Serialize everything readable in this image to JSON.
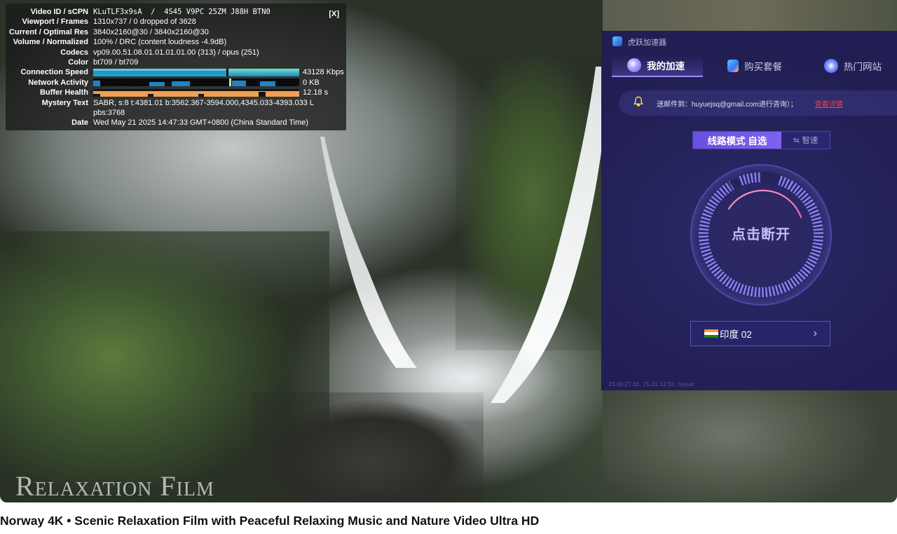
{
  "stats": {
    "close_label": "[X]",
    "rows": [
      {
        "key": "Video ID / sCPN",
        "value": "KLuTLF3x9sA  /  4S45 V9PC 25ZM J88H BTN0"
      },
      {
        "key": "Viewport / Frames",
        "value": "1310x737 / 0 dropped of 3628"
      },
      {
        "key": "Current / Optimal Res",
        "value": "3840x2160@30 / 3840x2160@30"
      },
      {
        "key": "Volume / Normalized",
        "value": "100% / DRC (content loudness -4.9dB)"
      },
      {
        "key": "Codecs",
        "value": "vp09.00.51.08.01.01.01.01.00 (313) / opus (251)"
      },
      {
        "key": "Color",
        "value": "bt709 / bt709"
      },
      {
        "key": "Connection Speed",
        "value": "43128 Kbps"
      },
      {
        "key": "Network Activity",
        "value": "0 KB"
      },
      {
        "key": "Buffer Health",
        "value": "12.18 s"
      },
      {
        "key": "Mystery Text",
        "value": "SABR, s:8 t:4381.01 b:3562.367-3594.000,4345.033-4393.033 L",
        "value2": "pbs:3768"
      },
      {
        "key": "Date",
        "value": "Wed May 21 2025 14:47:33 GMT+0800 (China Standard Time)"
      }
    ]
  },
  "watermark": "Relaxation Film",
  "app": {
    "title": "虎跃加速器",
    "tabs": [
      {
        "label": "我的加速",
        "icon": "rocket-icon",
        "active": true
      },
      {
        "label": "购买套餐",
        "icon": "shopping-bag-icon"
      },
      {
        "label": "热门网站",
        "icon": "compass-icon"
      }
    ],
    "notice": {
      "text": "送邮件到：huyuejsq@gmail.com进行咨询）；",
      "link": "查看详情",
      "icon": "bell-icon"
    },
    "mode": {
      "selected": "线路模式 自选",
      "other": "≒ 智速"
    },
    "dial_label": "点击断开",
    "server": {
      "name": "印度 02",
      "flag": "india-flag-icon",
      "chevron": "›"
    },
    "footer": "24.09.27.01, 25.01.12.52, huyue"
  },
  "video_title": "Norway 4K • Scenic Relaxation Film with Peaceful Relaxing Music and Nature Video Ultra HD",
  "colors": {
    "app_bg": "#25235c",
    "accent": "#7b63ee",
    "stats_speed": "#2196c8",
    "stats_buffer": "#f0a050",
    "link_red": "#ff3b3b"
  }
}
